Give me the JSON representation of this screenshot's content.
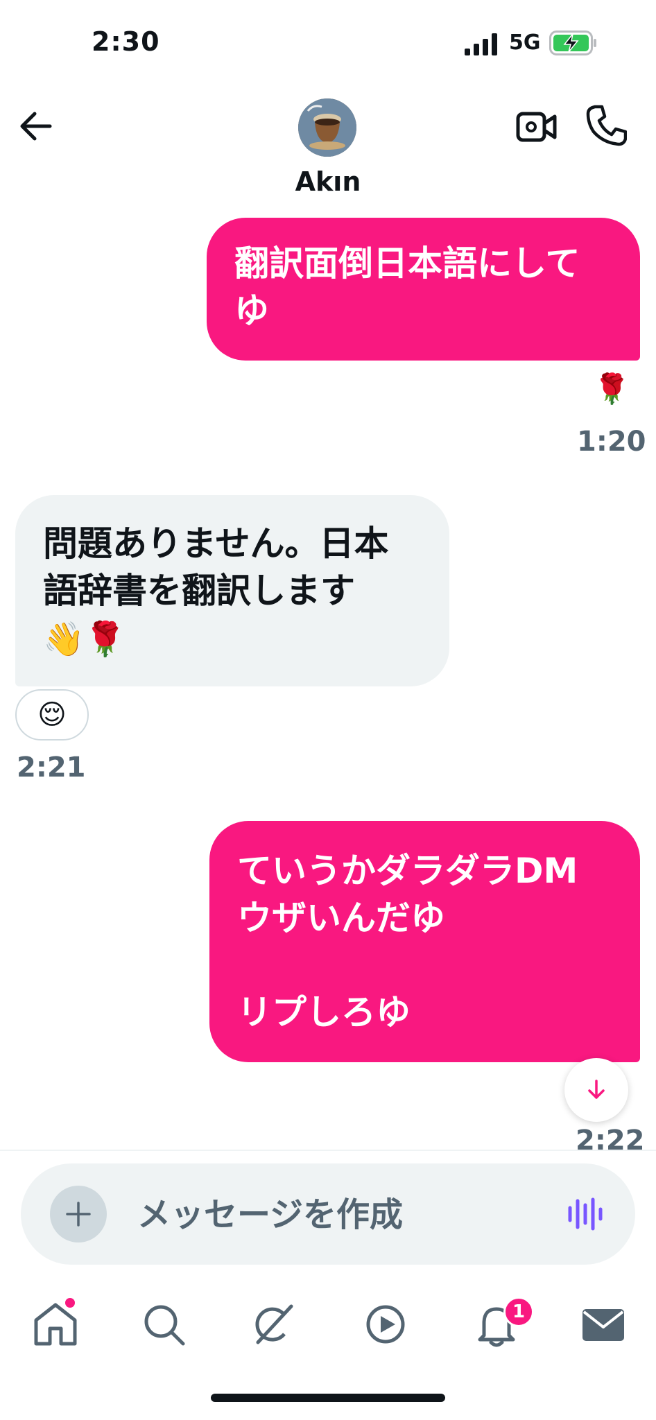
{
  "status_bar": {
    "time": "2:30",
    "network": "5G"
  },
  "header": {
    "contact_name": "Akın"
  },
  "messages": [
    {
      "direction": "outgoing",
      "lines": [
        "翻訳面倒日本語にして",
        "ゆ"
      ],
      "reaction": "🌹",
      "time": "1:20"
    },
    {
      "direction": "incoming",
      "lines": [
        "問題ありません。日本",
        "語辞書を翻訳します"
      ],
      "emoji_line": "👋🌹",
      "reaction": "😌",
      "time": "2:21"
    },
    {
      "direction": "outgoing",
      "lines": [
        "ていうかダラダラDM",
        "ウザいんだゆ",
        "",
        "リプしろゆ"
      ],
      "time": "2:22"
    }
  ],
  "composer": {
    "placeholder": "メッセージを作成"
  },
  "tabs": {
    "notifications_badge": "1"
  },
  "colors": {
    "accent": "#f91880",
    "incoming_bubble": "#eff3f4",
    "secondary_text": "#536471",
    "voice_icon": "#7856ff"
  }
}
